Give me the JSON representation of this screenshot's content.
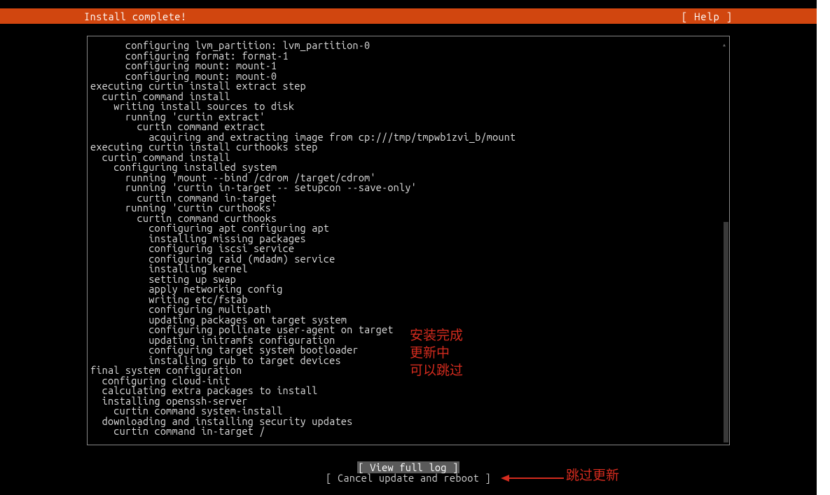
{
  "header": {
    "title": "Install complete!",
    "help": "[ Help ]"
  },
  "log_lines": [
    "      configuring lvm_partition: lvm_partition-0",
    "      configuring format: format-1",
    "      configuring mount: mount-1",
    "      configuring mount: mount-0",
    "executing curtin install extract step",
    "  curtin command install",
    "    writing install sources to disk",
    "      running 'curtin extract'",
    "        curtin command extract",
    "          acquiring and extracting image from cp:///tmp/tmpwb1zvi_b/mount",
    "executing curtin install curthooks step",
    "  curtin command install",
    "    configuring installed system",
    "      running 'mount --bind /cdrom /target/cdrom'",
    "      running 'curtin in-target -- setupcon --save-only'",
    "        curtin command in-target",
    "      running 'curtin curthooks'",
    "        curtin command curthooks",
    "          configuring apt configuring apt",
    "          installing missing packages",
    "          configuring iscsi service",
    "          configuring raid (mdadm) service",
    "          installing kernel",
    "          setting up swap",
    "          apply networking config",
    "          writing etc/fstab",
    "          configuring multipath",
    "          updating packages on target system",
    "          configuring pollinate user-agent on target",
    "          updating initramfs configuration",
    "          configuring target system bootloader",
    "          installing grub to target devices",
    "final system configuration",
    "  configuring cloud-init",
    "  calculating extra packages to install",
    "  installing openssh-server",
    "    curtin command system-install",
    "  downloading and installing security updates",
    "    curtin command in-target /"
  ],
  "buttons": {
    "view_log": "[ View full log         ]",
    "cancel": "[ Cancel update and reboot ]"
  },
  "annotations": {
    "line1": "安装完成",
    "line2": "更新中",
    "line3": "可以跳过",
    "skip": "跳过更新"
  },
  "scroll_up_glyph": "▴"
}
